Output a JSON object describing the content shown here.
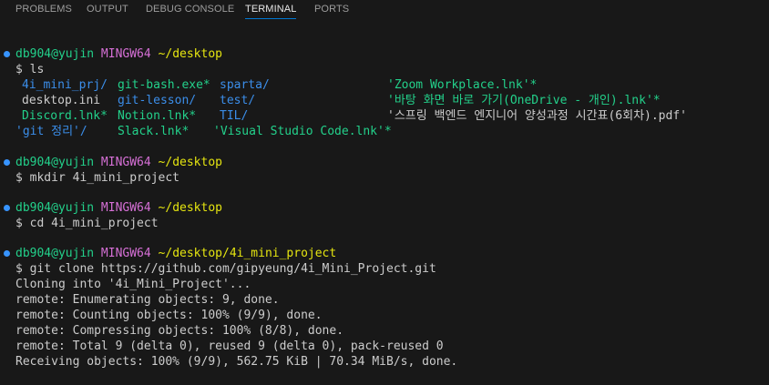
{
  "tabs": [
    {
      "label": "PROBLEMS",
      "active": false
    },
    {
      "label": "OUTPUT",
      "active": false
    },
    {
      "label": "DEBUG CONSOLE",
      "active": false
    },
    {
      "label": "TERMINAL",
      "active": true
    },
    {
      "label": "PORTS",
      "active": false
    }
  ],
  "prompts": [
    {
      "user": "db904@yujin",
      "host": "MINGW64",
      "path": "~/desktop",
      "command": "$ ls"
    },
    {
      "user": "db904@yujin",
      "host": "MINGW64",
      "path": "~/desktop",
      "command": "$ mkdir 4i_mini_project"
    },
    {
      "user": "db904@yujin",
      "host": "MINGW64",
      "path": "~/desktop",
      "command": "$ cd 4i_mini_project"
    },
    {
      "user": "db904@yujin",
      "host": "MINGW64",
      "path": "~/desktop/4i_mini_project",
      "command": "$ git clone https://github.com/gipyeung/4i_Mini_Project.git"
    }
  ],
  "ls_output": {
    "col1": [
      "4i_mini_prj/",
      "desktop.ini",
      "Discord.lnk*",
      "'git 정리'/"
    ],
    "col2": [
      "git-bash.exe*",
      "git-lesson/",
      "Notion.lnk*",
      "Slack.lnk*"
    ],
    "col3": [
      "sparta/",
      "test/",
      "TIL/",
      "'Visual Studio Code.lnk'*"
    ],
    "col4": [
      "'Zoom Workplace.lnk'*",
      "'바탕 화면 바로 가기(OneDrive - 개인).lnk'*",
      "'스프링 백엔드 엔지니어 양성과정 시간표(6회차).pdf'"
    ]
  },
  "clone_output": [
    "Cloning into '4i_Mini_Project'...",
    "remote: Enumerating objects: 9, done.",
    "remote: Counting objects: 100% (9/9), done.",
    "remote: Compressing objects: 100% (8/8), done.",
    "remote: Total 9 (delta 0), reused 9 (delta 0), pack-reused 0",
    "Receiving objects: 100% (9/9), 562.75 KiB | 70.34 MiB/s, done."
  ],
  "colors": {
    "background": "#181818",
    "user": "#23d18b",
    "host": "#d670d6",
    "path": "#e5e510",
    "directory": "#3b8eea",
    "executable": "#23d18b",
    "symlink": "#29b8db",
    "prompt_dot": "#3794ff",
    "active_tab_underline": "#0078d4"
  }
}
